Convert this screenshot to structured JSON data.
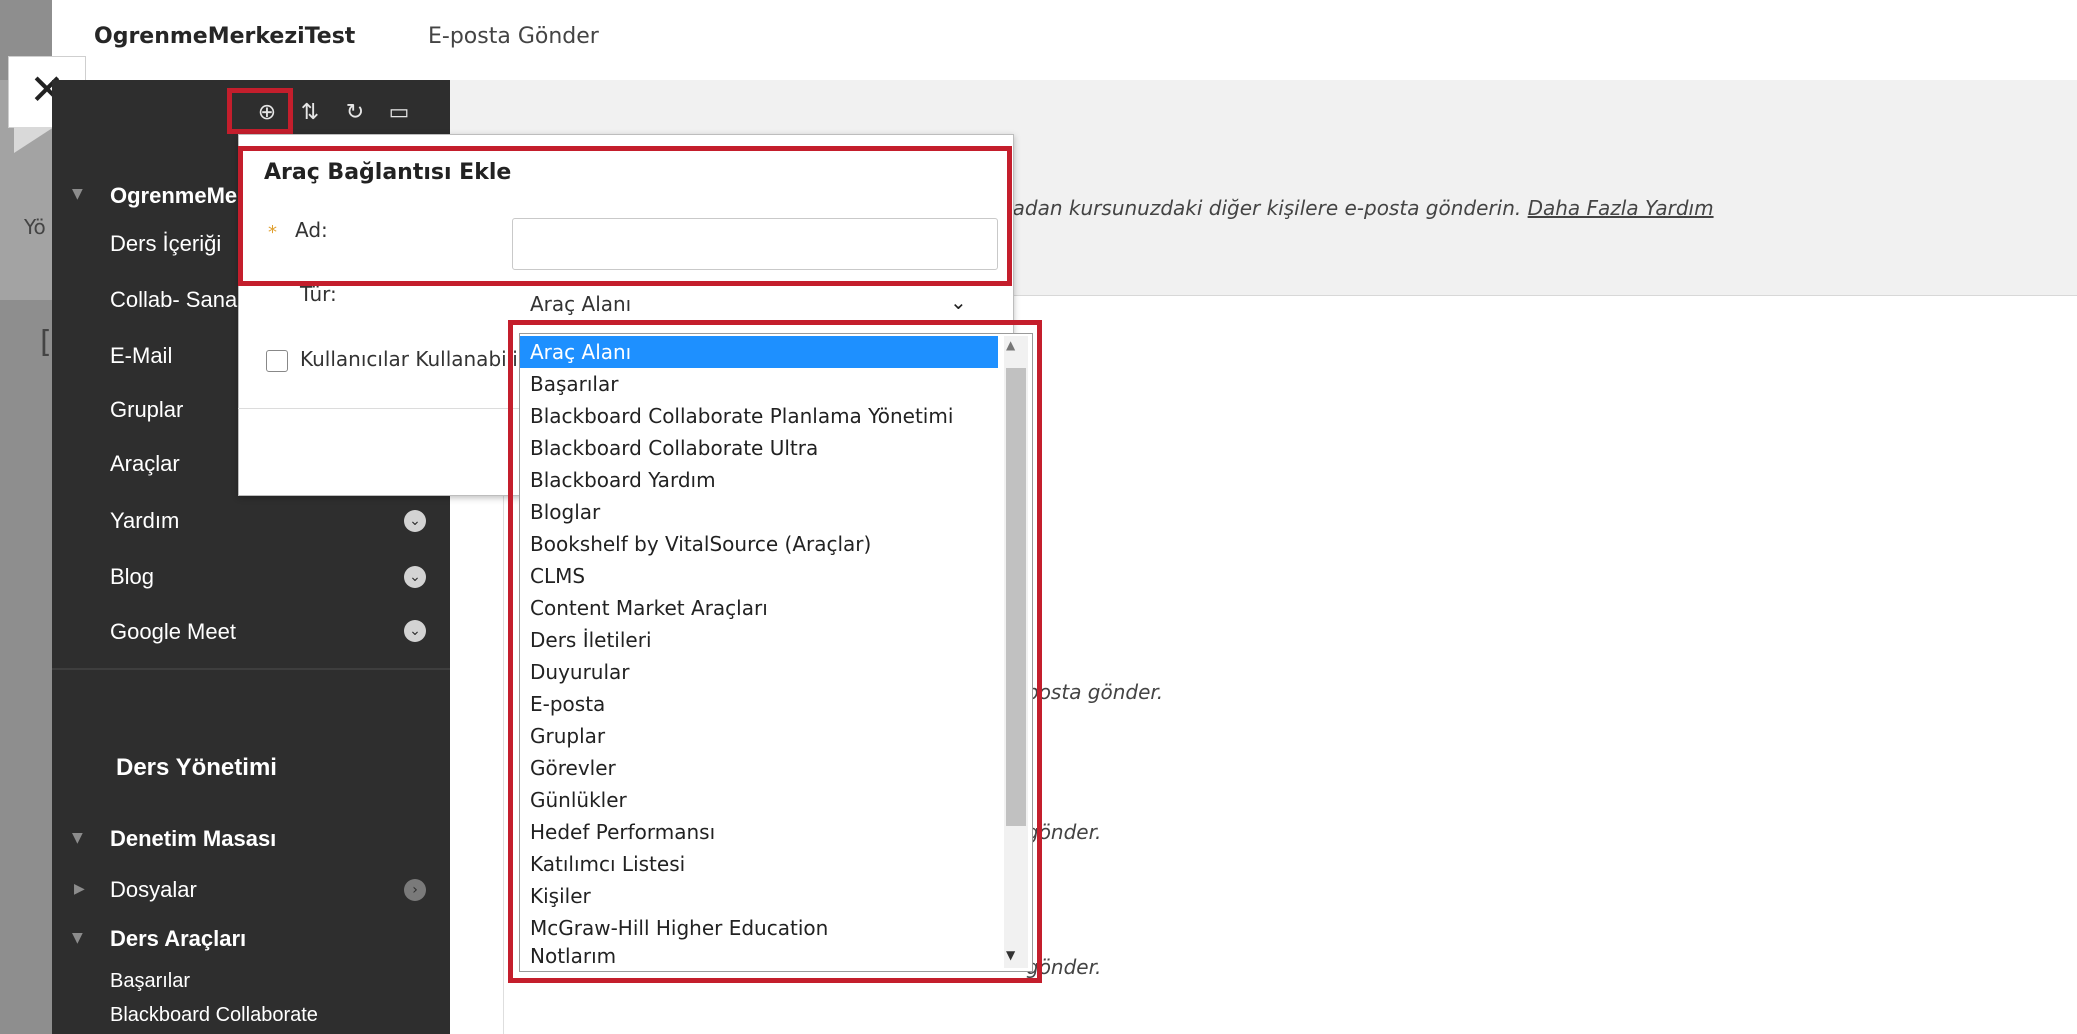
{
  "topbar": {
    "course_title": "OgrenmeMerkeziTest",
    "page_title": "E-posta Gönder"
  },
  "close": {
    "label": "✕"
  },
  "main": {
    "help_text_prefix": "nadan kursunuzdaki diğer kişilere e-posta gönderin.",
    "help_link": "Daha Fazla Yardım",
    "left_fragment": "Yö",
    "d_fragment": "[",
    "item_descriptions": [
      "posta gönder.",
      "gönder.",
      "gönder."
    ]
  },
  "sidebar_toolbar": {
    "add_icon": "plus-circle-icon",
    "sort_icon": "sort-icon",
    "refresh_icon": "refresh-icon",
    "folder_icon": "folder-icon"
  },
  "sidebar": {
    "course_menu_header": "OgrenmeMerkeziTest",
    "items": [
      {
        "label": "Ders İçeriği"
      },
      {
        "label": "Collab- Sanal Sınıf"
      },
      {
        "label": "E-Mail"
      },
      {
        "label": "Gruplar"
      },
      {
        "label": "Araçlar"
      },
      {
        "label": "Yardım"
      },
      {
        "label": "Blog"
      },
      {
        "label": "Google Meet"
      }
    ],
    "management_title": "Ders Yönetimi",
    "control_panel": "Denetim Masası",
    "files": "Dosyalar",
    "course_tools": "Ders Araçları",
    "course_tool_items": [
      "Başarılar",
      "Blackboard Collaborate"
    ]
  },
  "popup": {
    "title": "Araç Bağlantısı Ekle",
    "required_mark": "*",
    "name_label": "Ad:",
    "name_value": "",
    "type_label": "Tür:",
    "type_selected": "Araç Alanı",
    "checkbox_label": "Kullanıcılar Kullanabilir"
  },
  "dropdown": {
    "selected": "Araç Alanı",
    "options": [
      "Araç Alanı",
      "Başarılar",
      "Blackboard Collaborate Planlama Yönetimi",
      "Blackboard Collaborate Ultra",
      "Blackboard Yardım",
      "Bloglar",
      "Bookshelf by VitalSource (Araçlar)",
      "CLMS",
      "Content Market Araçları",
      "Ders İletileri",
      "Duyurular",
      "E-posta",
      "Gruplar",
      "Görevler",
      "Günlükler",
      "Hedef Performansı",
      "Katılımcı Listesi",
      "Kişiler",
      "McGraw-Hill Higher Education",
      "Notlarım"
    ]
  },
  "colors": {
    "highlight_red": "#c41e2c",
    "sidebar_bg": "#2e2e2e",
    "selected_option": "#1e90ff"
  }
}
